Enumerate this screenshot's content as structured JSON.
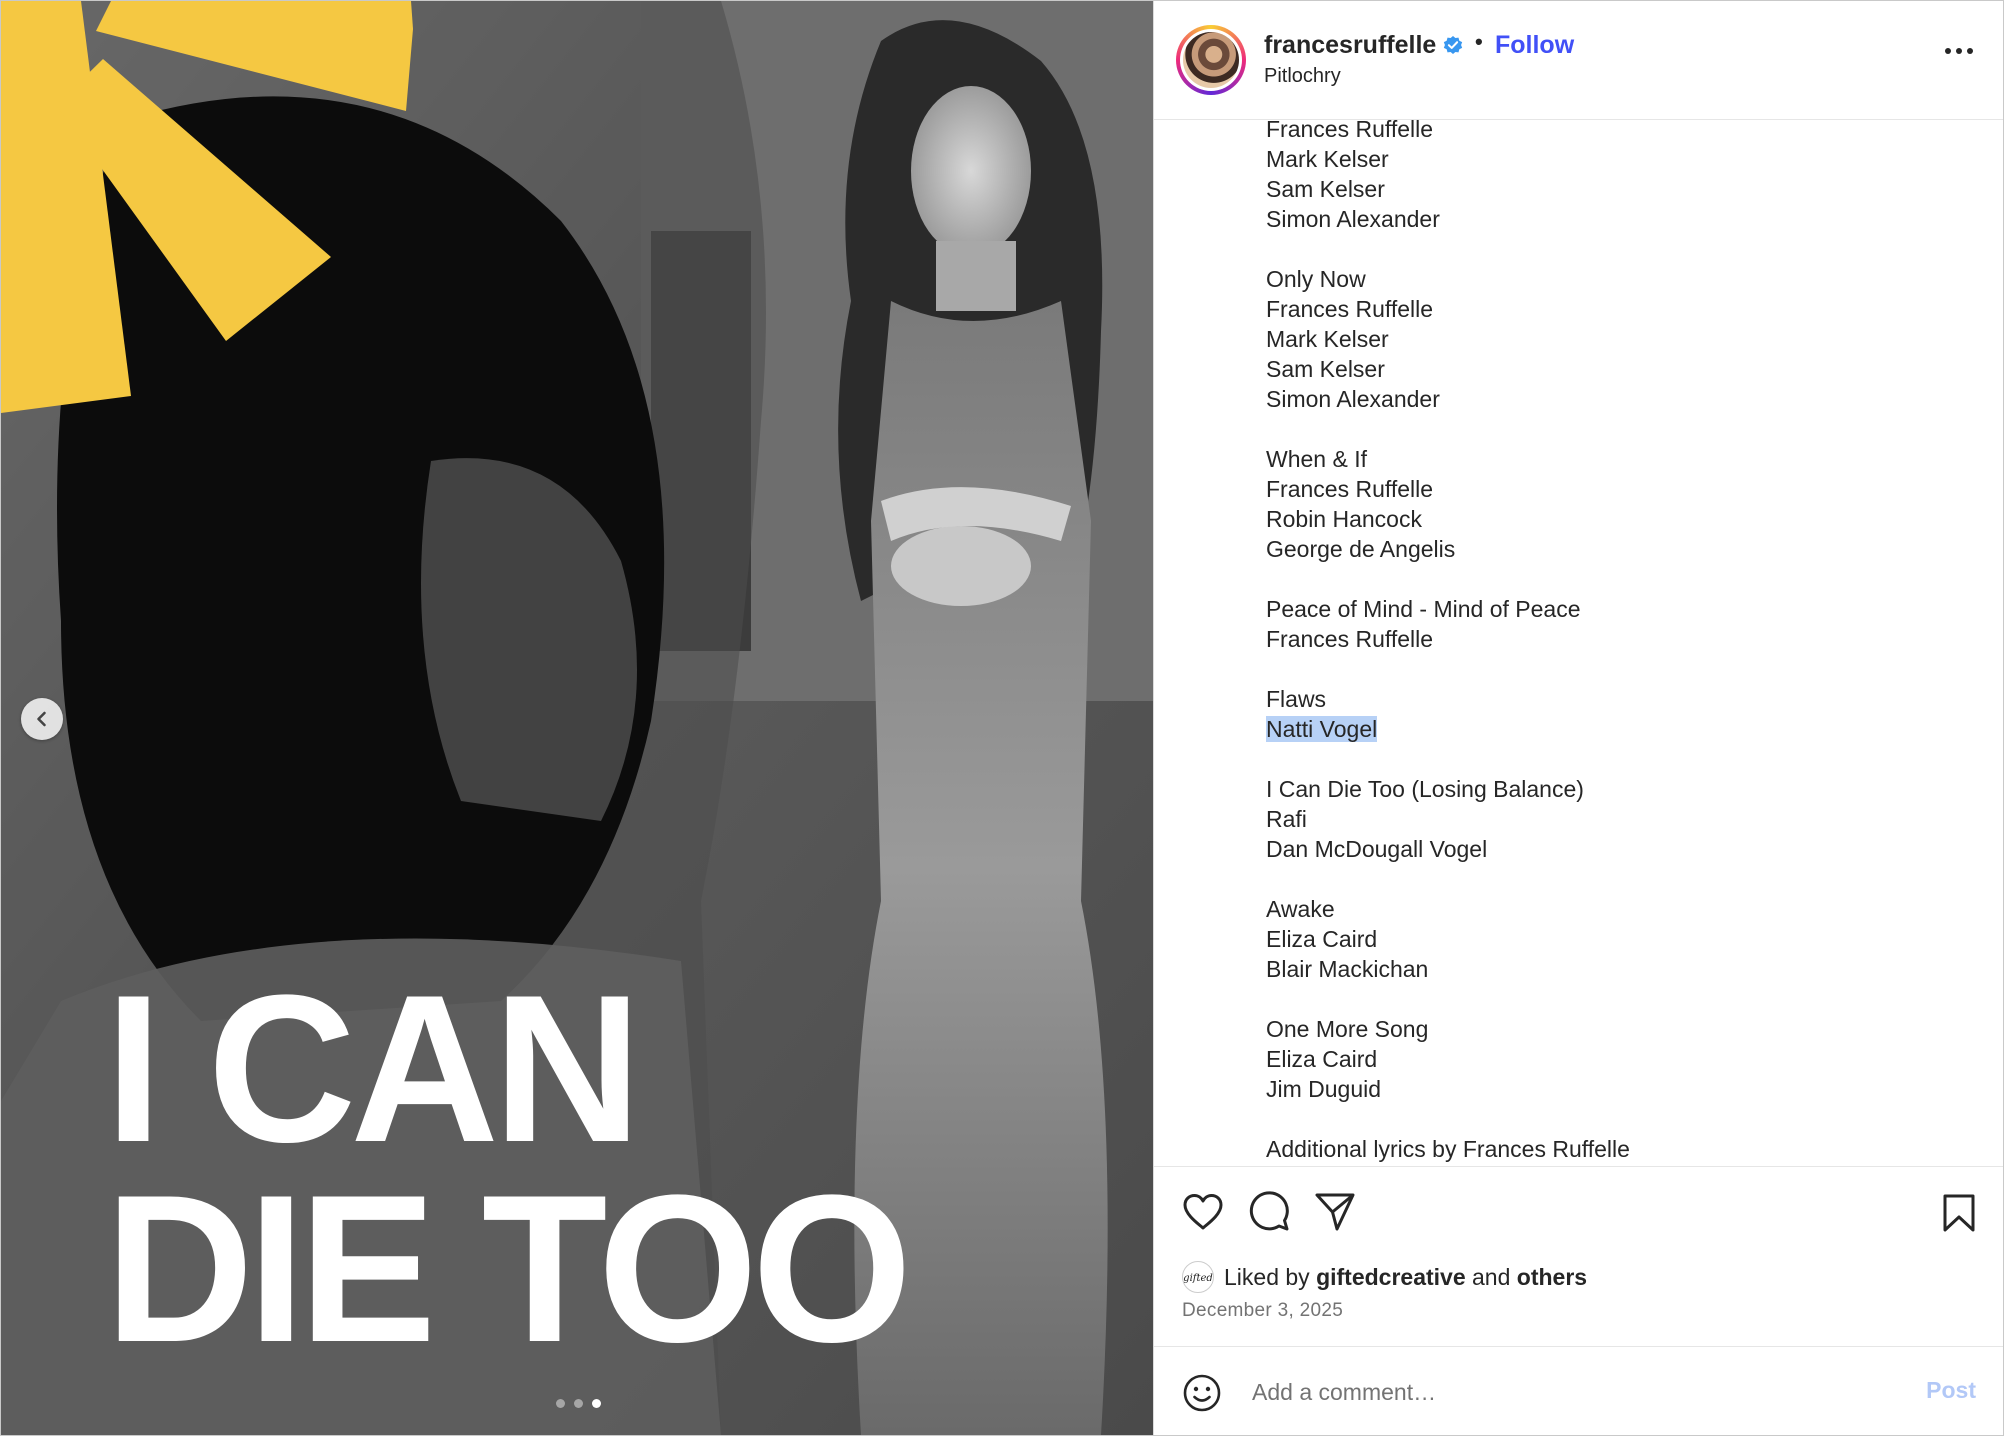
{
  "media": {
    "headline_line1": "I CAN",
    "headline_line2": "DIE TOO",
    "accent_color": "#f5c842",
    "carousel": {
      "total": 3,
      "active": 3
    }
  },
  "post": {
    "username": "francesruffelle",
    "verified": true,
    "follow_label": "Follow",
    "separator": "•",
    "location": "Pitlochry"
  },
  "caption": {
    "lines": [
      "Frances Ruffelle",
      "Mark Kelser",
      "Sam Kelser",
      "Simon Alexander",
      "",
      "Only Now",
      "Frances Ruffelle",
      "Mark Kelser",
      "Sam Kelser",
      "Simon Alexander",
      "",
      "When & If",
      "Frances Ruffelle",
      "Robin Hancock",
      "George de Angelis",
      "",
      "Peace of Mind - Mind of Peace",
      "Frances Ruffelle",
      "",
      "Flaws",
      "Natti Vogel",
      "",
      "I Can Die Too (Losing Balance)",
      "Rafi",
      "Dan McDougall Vogel",
      "",
      "Awake",
      "Eliza Caird",
      "Blair Mackichan",
      "",
      "One More Song",
      "Eliza Caird",
      "Jim Duguid",
      "",
      "Additional lyrics by Frances Ruffelle"
    ],
    "highlighted_line": "Natti Vogel"
  },
  "engagement": {
    "liked_prefix": "Liked by",
    "liked_user": "giftedcreative",
    "liked_and": "and",
    "liked_others": "others",
    "date": "December 3, 2025"
  },
  "comment": {
    "placeholder": "Add a comment…",
    "post_label": "Post"
  },
  "icons": {
    "like": "heart-icon",
    "comment": "comment-icon",
    "share": "share-icon",
    "save": "bookmark-icon",
    "emoji": "emoji-icon",
    "more": "more-options-icon",
    "prev": "chevron-left-icon",
    "verified": "verified-badge-icon"
  },
  "colors": {
    "follow": "#4150f7",
    "post_disabled": "#b2c8f7",
    "selection": "#b7d1f6"
  }
}
